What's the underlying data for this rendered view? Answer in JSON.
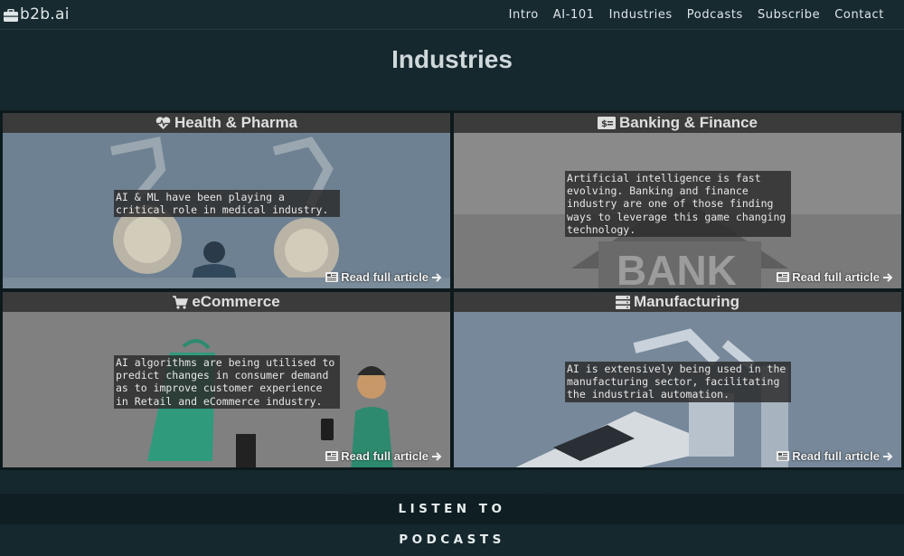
{
  "nav": {
    "brand": "b2b.ai",
    "links": [
      "Intro",
      "AI-101",
      "Industries",
      "Podcasts",
      "Subscribe",
      "Contact"
    ]
  },
  "page": {
    "title": "Industries"
  },
  "cards": [
    {
      "title": "Health & Pharma",
      "icon": "heartbeat-icon",
      "description": "AI & ML have been playing a critical role in medical industry.",
      "link_label": "Read full article"
    },
    {
      "title": "Banking & Finance",
      "icon": "money-bill-icon",
      "description": "Artificial intelligence is fast evolving. Banking and finance industry are one of those finding ways to leverage this game changing technology.",
      "link_label": "Read full article",
      "image_text": "BANK"
    },
    {
      "title": "eCommerce",
      "icon": "shopping-cart-icon",
      "description": "AI algorithms are being utilised to predict changes in consumer demand as to improve customer experience in Retail and eCommerce industry.",
      "link_label": "Read full article"
    },
    {
      "title": "Manufacturing",
      "icon": "server-icon",
      "description": "AI is extensively being used in the manufacturing sector, facilitating the industrial automation.",
      "link_label": "Read full article"
    }
  ],
  "podcast": {
    "label": "LISTEN TO PODCASTS"
  },
  "colors": {
    "background": "#15282e",
    "card_header": "#3b3b3b",
    "text": "#e6e6e6"
  }
}
